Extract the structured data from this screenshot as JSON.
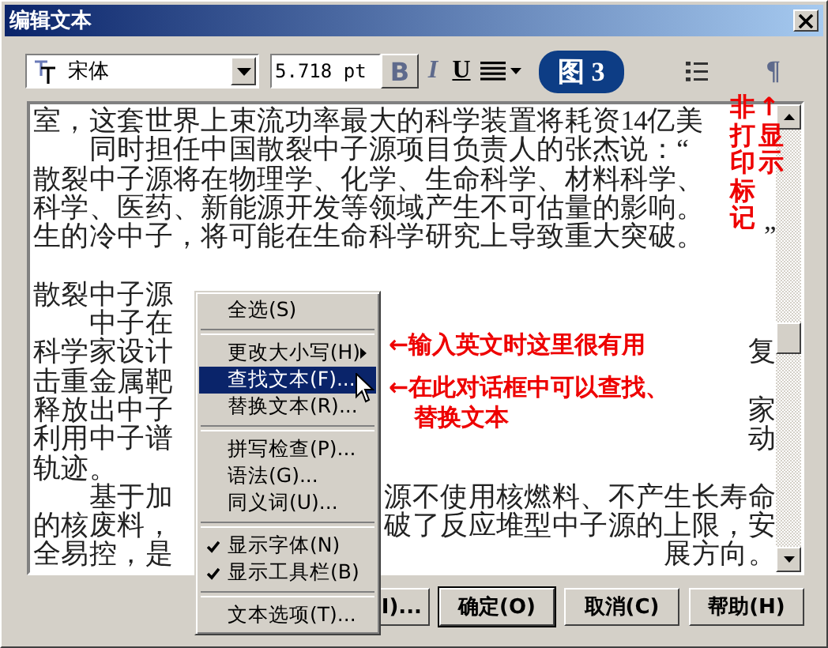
{
  "window": {
    "title": "编辑文本"
  },
  "toolbar": {
    "font": "宋体",
    "size": "5.718 pt",
    "figure_label": "图 3",
    "tools": [
      {
        "kind": "bold",
        "label": "B",
        "disabled": true
      },
      {
        "kind": "italic",
        "label": "I",
        "disabled": true
      },
      {
        "kind": "underline",
        "label": "U",
        "disabled": false
      },
      {
        "kind": "align",
        "disabled": false
      },
      {
        "kind": "list",
        "disabled": false
      },
      {
        "kind": "pilcrow",
        "label": "¶",
        "disabled": true
      }
    ]
  },
  "text_lines": [
    {
      "kind": "text",
      "left": "室，这套世界上束流功率最大的科学装置将耗资14亿美"
    },
    {
      "kind": "text",
      "left": "　　同时担任中国散裂中子源项目负责人的张杰说：“"
    },
    {
      "kind": "text",
      "left": "散裂中子源将在物理学、化学、生命科学、材料科学、"
    },
    {
      "kind": "text",
      "left": "科学、医药、新能源开发等领域产生不可估量的影响。"
    },
    {
      "kind": "text",
      "left": "生的冷中子，将可能在生命科学研究上导致重大突破。",
      "right": "”"
    },
    {
      "kind": "blank"
    },
    {
      "kind": "text",
      "left": "散裂中子源"
    },
    {
      "kind": "text",
      "left": "　　中子在"
    },
    {
      "kind": "text",
      "left": "科学家设计",
      "right": "复"
    },
    {
      "kind": "text",
      "left": "击重金属靶"
    },
    {
      "kind": "text",
      "left": "释放出中子",
      "right": "家"
    },
    {
      "kind": "text",
      "left": "利用中子谱",
      "right": "动"
    },
    {
      "kind": "text",
      "left": "轨迹。"
    },
    {
      "kind": "text",
      "left": "　　基于加",
      "right": "源不使用核燃料、不产生长寿命"
    },
    {
      "kind": "text",
      "left": "的核废料，",
      "right": "破了反应堆型中子源的上限，安"
    },
    {
      "kind": "text",
      "left": "全易控，是",
      "right": "展方向。"
    }
  ],
  "context_menu": [
    {
      "kind": "item",
      "label": "全选(S)",
      "selected": false,
      "checked": false
    },
    {
      "kind": "separator"
    },
    {
      "kind": "submenu",
      "label": "更改大小写(H)",
      "selected": false,
      "checked": false
    },
    {
      "kind": "item",
      "label": "查找文本(F)...",
      "selected": true,
      "checked": false
    },
    {
      "kind": "item",
      "label": "替换文本(R)...",
      "selected": false,
      "checked": false
    },
    {
      "kind": "separator"
    },
    {
      "kind": "item",
      "label": "拼写检查(P)...",
      "selected": false,
      "checked": false
    },
    {
      "kind": "item",
      "label": "语法(G)...",
      "selected": false,
      "checked": false
    },
    {
      "kind": "item",
      "label": "同义词(U)...",
      "selected": false,
      "checked": false
    },
    {
      "kind": "separator"
    },
    {
      "kind": "item",
      "label": "显示字体(N)",
      "selected": false,
      "checked": true
    },
    {
      "kind": "item",
      "label": "显示工具栏(B)",
      "selected": false,
      "checked": true
    },
    {
      "kind": "separator"
    },
    {
      "kind": "item",
      "label": "文本选项(T)...",
      "selected": false,
      "checked": false
    }
  ],
  "annotations": [
    {
      "lines": [
        "←输入英文时这里很有用"
      ]
    },
    {
      "lines": [
        "←在此对话框中可以查找、",
        "替换文本"
      ]
    }
  ],
  "vertical_notes": [
    "非打印标记",
    "↑显示"
  ],
  "buttons": [
    {
      "label": "I)...",
      "default": false
    },
    {
      "label": "确定(O)",
      "default": true
    },
    {
      "label": "取消(C)",
      "default": false
    },
    {
      "label": "帮助(H)",
      "default": false
    }
  ]
}
